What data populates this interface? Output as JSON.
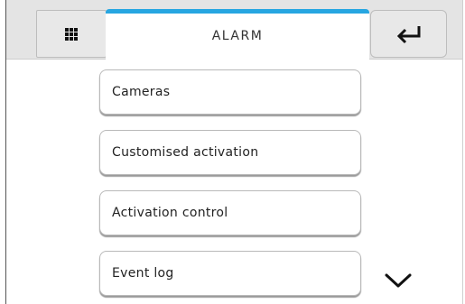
{
  "header": {
    "title": "ALARM",
    "menu_icon": "grid-icon",
    "back_icon": "return-arrow-icon"
  },
  "colors": {
    "accent": "#27a6e1",
    "bar": "#e4e4e4"
  },
  "menu": {
    "items": [
      {
        "label": "Cameras"
      },
      {
        "label": "Customised activation"
      },
      {
        "label": "Activation control"
      },
      {
        "label": "Event log"
      }
    ],
    "scroll_icon": "chevron-down-icon"
  }
}
